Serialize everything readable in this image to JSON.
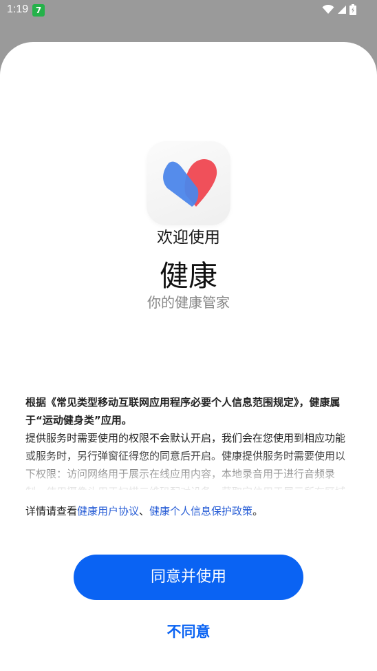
{
  "status_bar": {
    "time": "1:19",
    "notification_badge": "7",
    "icons": [
      "wifi-icon",
      "signal-icon",
      "battery-icon"
    ]
  },
  "app": {
    "icon": "heart-icon",
    "welcome": "欢迎使用",
    "name": "健康",
    "tagline": "你的健康管家"
  },
  "policy": {
    "bold_line_1": "根据《常见类型移动互联网应用程序必要个人信息范围规定》，健康属",
    "bold_line_2": "于“运动健身类”应用。",
    "body": "提供服务时需要使用的权限不会默认开启，我们会在您使用到相应功能或服务时，另行弹窗征得您的同意后开启。健康提供服务时需要使用以下权限：访问网络用于展示在线应用内容，本地录音用于进行音频录制，使用摄像头用于扫描二维码配对设备，获取定位用于展示所在区域"
  },
  "details": {
    "prefix": "详情请查看",
    "user_agreement": "健康用户协议",
    "separator": "、",
    "privacy_policy": "健康个人信息保护政策",
    "suffix": "。"
  },
  "buttons": {
    "agree": "同意并使用",
    "disagree": "不同意"
  },
  "colors": {
    "accent": "#0a63f3",
    "link": "#2a5fd6",
    "heart_blue": "#4c86ea",
    "heart_red": "#f0505a"
  }
}
